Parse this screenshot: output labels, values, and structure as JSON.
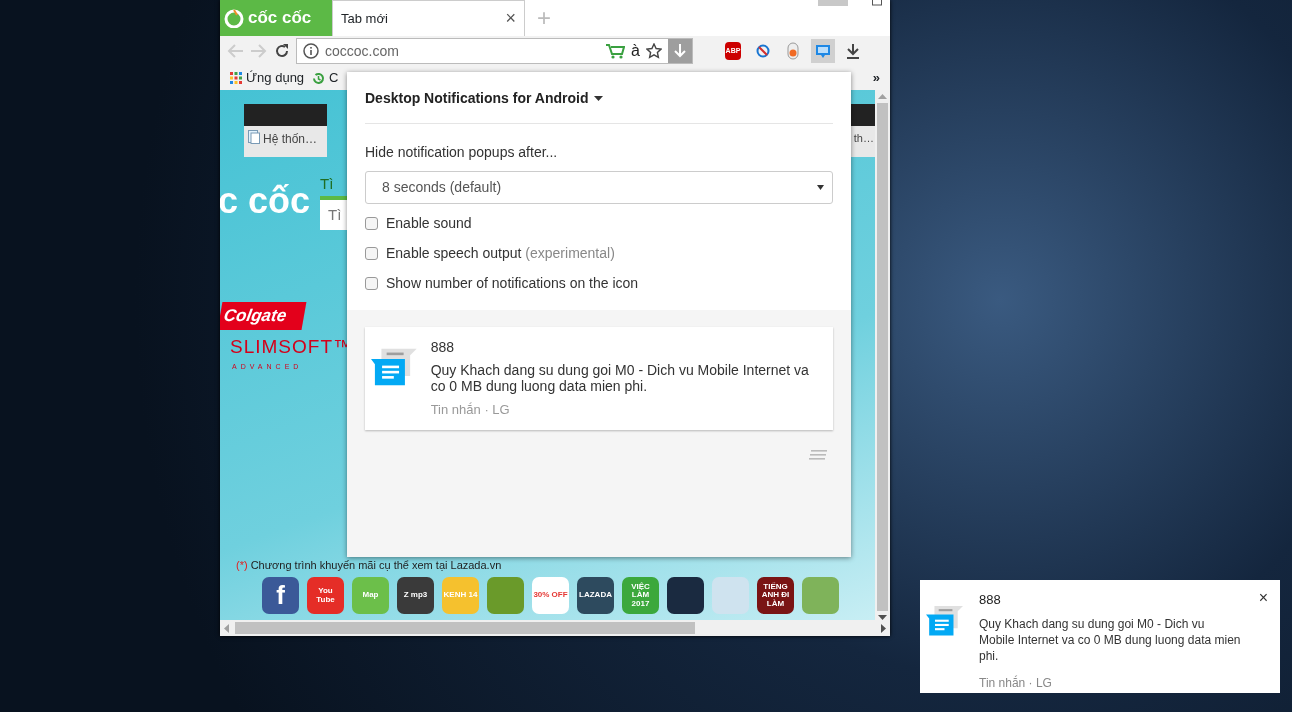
{
  "browser": {
    "logo": "cốc cốc",
    "tabs": [
      {
        "label": "Tab mới",
        "close": "×",
        "selected": true
      }
    ],
    "new_tab": "+",
    "address": "coccoc.com",
    "translit": "à",
    "extensions": [
      {
        "kind": "abp",
        "label": "ABP",
        "selected": false
      },
      {
        "kind": "block",
        "selected": false
      },
      {
        "kind": "pill",
        "selected": false
      },
      {
        "kind": "chat",
        "selected": true
      },
      {
        "kind": "download",
        "selected": false
      }
    ],
    "bookmarks": [
      {
        "kind": "apps",
        "label": "Ứng dụng"
      },
      {
        "kind": "history",
        "label": "C"
      }
    ],
    "bookmarks_more": "»"
  },
  "page": {
    "thumbnails": [
      {
        "label": "Hệ thốn…"
      },
      {
        "label": "th…"
      }
    ],
    "logo": "c cốc",
    "search_label": "Tì",
    "search_value": "Tì",
    "ad": {
      "brand": "Colgate",
      "product": "SLIMSOFT™",
      "sub": "ADVANCED"
    },
    "promo": {
      "mark": "(*)",
      "text": "Chương trình khuyến mãi cụ thể xem tại Lazada.vn"
    },
    "apps": [
      {
        "kind": "text",
        "label": "f",
        "color": "#3b5998"
      },
      {
        "kind": "text",
        "label": "You Tube",
        "color": "#e52d27"
      },
      {
        "kind": "text",
        "label": "Map",
        "color": "#6cbf4a"
      },
      {
        "kind": "text",
        "label": "Z mp3",
        "color": "#3a3a3a"
      },
      {
        "kind": "text",
        "label": "KENH 14",
        "color": "#f5c12e"
      },
      {
        "kind": "picture",
        "color": "#6a9a2a"
      },
      {
        "kind": "text",
        "label": "30% OFF",
        "color": "#ffffff"
      },
      {
        "kind": "text",
        "label": "LAZADA",
        "color": "#2d4a5e"
      },
      {
        "kind": "text",
        "label": "VIỆC LÀM 2017",
        "color": "#3ca83c"
      },
      {
        "kind": "picture",
        "color": "#1a2a40"
      },
      {
        "kind": "picture",
        "color": "#cfe3ef"
      },
      {
        "kind": "text",
        "label": "TIẾNG ANH ĐI LÀM",
        "color": "#7a1414"
      },
      {
        "kind": "picture",
        "color": "#7fb35a"
      }
    ]
  },
  "popup": {
    "title": "Desktop Notifications for Android",
    "hide_label": "Hide notification popups after...",
    "hide_value": "8 seconds (default)",
    "options": [
      {
        "label": "Enable sound",
        "checked": false
      },
      {
        "label": "Enable speech output",
        "note": "(experimental)",
        "checked": false
      },
      {
        "label": "Show number of notifications on the icon",
        "checked": false
      }
    ],
    "notification": {
      "title": "888",
      "body": "Quy Khach dang su dung goi M0 - Dich vu Mobile Internet va co 0 MB dung luong data mien phi.",
      "meta": "Tin nhắn · LG"
    }
  },
  "toast": {
    "title": "888",
    "body": "Quy Khach dang su dung goi M0 - Dich vu Mobile Internet va co 0 MB dung luong data mien phi.",
    "meta": "Tin nhắn · LG",
    "close": "×"
  }
}
